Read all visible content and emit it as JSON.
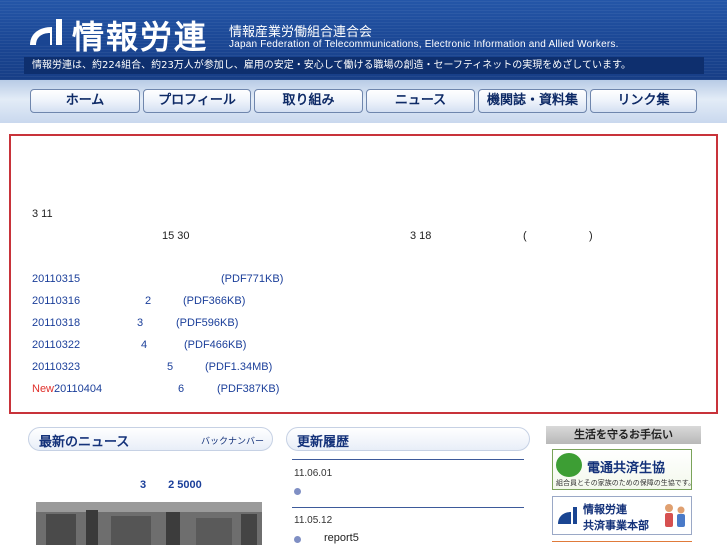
{
  "header": {
    "title": "情報労連",
    "subtitle": "情報産業労働組合連合会",
    "english": "Japan Federation of Telecommunications, Electronic Information and Allied Workers.",
    "tagline": "情報労連は、約224組合、約23万人が参加し、雇用の安定・安心して働ける職場の創造・セーフティネットの実現をめざしています。"
  },
  "nav": [
    "ホーム",
    "プロフィール",
    "取り組み",
    "ニュース",
    "機関誌・資料集",
    "リンク集"
  ],
  "notice": {
    "line1": "3 11",
    "line2a": "15 30",
    "line2b": "3 18",
    "line2c": "(",
    "line2d": ")",
    "links": [
      {
        "new": "",
        "date": "20110315",
        "mid": "",
        "file": "(PDF771KB)"
      },
      {
        "new": "",
        "date": "20110316",
        "mid": "2",
        "file": "(PDF366KB)"
      },
      {
        "new": "",
        "date": "20110318",
        "mid": "3",
        "file": "(PDF596KB)"
      },
      {
        "new": "",
        "date": "20110322",
        "mid": "4",
        "file": "(PDF466KB)"
      },
      {
        "new": "",
        "date": "20110323",
        "mid": "5",
        "file": "(PDF1.34MB)"
      },
      {
        "new": "New",
        "date": "20110404",
        "mid": "6",
        "file": "(PDF387KB)"
      }
    ]
  },
  "news": {
    "title": "最新のニュース",
    "backnumber": "バックナンバー",
    "headline": "3　　2 5000"
  },
  "updates": {
    "title": "更新履歴",
    "items": [
      {
        "date": "11.06.01",
        "text": ""
      },
      {
        "date": "11.05.12",
        "text": "report5"
      }
    ]
  },
  "side": {
    "title": "生活を守るお手伝い",
    "banner1_main": "電通共済生協",
    "banner1_sub": "組合員とその家族のための保障の生協です。",
    "banner2_line1": "情報労連",
    "banner2_line2": "共済事業本部"
  },
  "colors": {
    "header_bg": "#1a4592",
    "notice_border": "#c8333a",
    "link": "#1b3f9a",
    "new_tag": "#e0302b"
  }
}
